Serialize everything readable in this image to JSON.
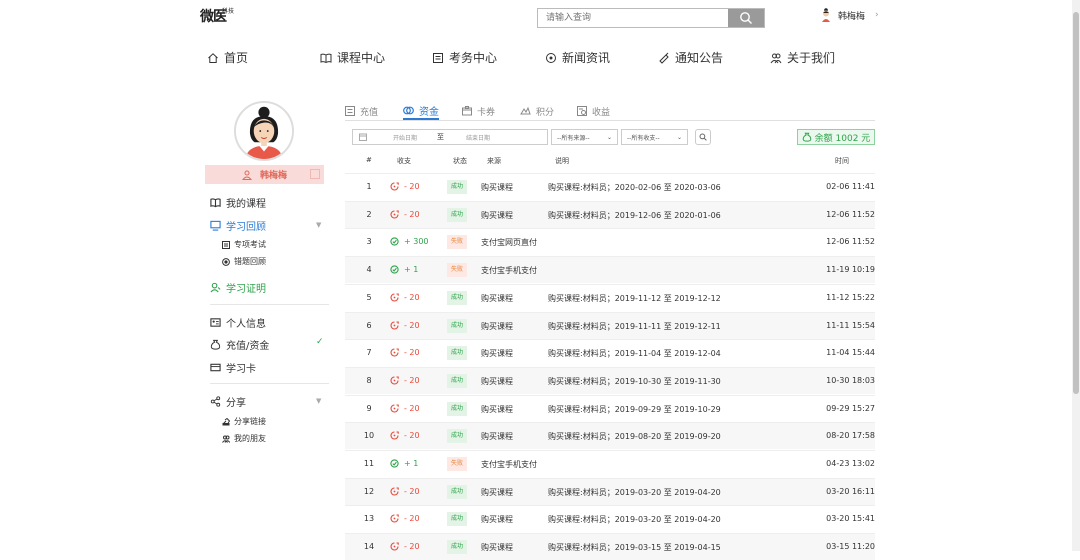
{
  "header": {
    "logo_text": "微医",
    "logo_sub": "科技",
    "search_placeholder": "请输入查询",
    "username": "韩梅梅"
  },
  "nav": [
    {
      "label": "首页",
      "icon": "home-icon"
    },
    {
      "label": "课程中心",
      "icon": "book-icon"
    },
    {
      "label": "考务中心",
      "icon": "exam-icon"
    },
    {
      "label": "新闻资讯",
      "icon": "news-icon"
    },
    {
      "label": "通知公告",
      "icon": "megaphone-icon"
    },
    {
      "label": "关于我们",
      "icon": "people-icon"
    }
  ],
  "sidebar": {
    "username": "韩梅梅",
    "items": [
      {
        "label": "我的课程"
      },
      {
        "label": "学习回顾"
      },
      {
        "label": "专项考试"
      },
      {
        "label": "错题回顾"
      },
      {
        "label": "学习证明"
      },
      {
        "label": "个人信息"
      },
      {
        "label": "充值/资金"
      },
      {
        "label": "学习卡"
      },
      {
        "label": "分享"
      },
      {
        "label": "分享链接"
      },
      {
        "label": "我的朋友"
      }
    ]
  },
  "tabs": [
    {
      "label": "充值"
    },
    {
      "label": "资金"
    },
    {
      "label": "卡券"
    },
    {
      "label": "积分"
    },
    {
      "label": "收益"
    }
  ],
  "filters": {
    "start_placeholder": "开始日期",
    "to_label": "至",
    "end_placeholder": "结束日期",
    "source_select": "--所有来源--",
    "type_select": "--所有收支--"
  },
  "balance": "余额 1002 元",
  "table": {
    "columns": [
      "#",
      "收支",
      "状态",
      "来源",
      "说明",
      "时间"
    ],
    "rows": [
      {
        "idx": "1",
        "amount": "- 20",
        "type": "out",
        "status": "成功",
        "st": "ok",
        "source": "购买课程",
        "desc": "购买课程:材料员；2020-02-06 至 2020-03-06",
        "time": "02-06 11:41"
      },
      {
        "idx": "2",
        "amount": "- 20",
        "type": "out",
        "status": "成功",
        "st": "ok",
        "source": "购买课程",
        "desc": "购买课程:材料员；2019-12-06 至 2020-01-06",
        "time": "12-06 11:52"
      },
      {
        "idx": "3",
        "amount": "+ 300",
        "type": "in",
        "status": "失败",
        "st": "fail",
        "source": "支付宝网页直付",
        "desc": "",
        "time": "12-06 11:52"
      },
      {
        "idx": "4",
        "amount": "+ 1",
        "type": "in",
        "status": "失败",
        "st": "fail",
        "source": "支付宝手机支付",
        "desc": "",
        "time": "11-19 10:19"
      },
      {
        "idx": "5",
        "amount": "- 20",
        "type": "out",
        "status": "成功",
        "st": "ok",
        "source": "购买课程",
        "desc": "购买课程:材料员；2019-11-12 至 2019-12-12",
        "time": "11-12 15:22"
      },
      {
        "idx": "6",
        "amount": "- 20",
        "type": "out",
        "status": "成功",
        "st": "ok",
        "source": "购买课程",
        "desc": "购买课程:材料员；2019-11-11 至 2019-12-11",
        "time": "11-11 15:54"
      },
      {
        "idx": "7",
        "amount": "- 20",
        "type": "out",
        "status": "成功",
        "st": "ok",
        "source": "购买课程",
        "desc": "购买课程:材料员；2019-11-04 至 2019-12-04",
        "time": "11-04 15:44"
      },
      {
        "idx": "8",
        "amount": "- 20",
        "type": "out",
        "status": "成功",
        "st": "ok",
        "source": "购买课程",
        "desc": "购买课程:材料员；2019-10-30 至 2019-11-30",
        "time": "10-30 18:03"
      },
      {
        "idx": "9",
        "amount": "- 20",
        "type": "out",
        "status": "成功",
        "st": "ok",
        "source": "购买课程",
        "desc": "购买课程:材料员；2019-09-29 至 2019-10-29",
        "time": "09-29 15:27"
      },
      {
        "idx": "10",
        "amount": "- 20",
        "type": "out",
        "status": "成功",
        "st": "ok",
        "source": "购买课程",
        "desc": "购买课程:材料员；2019-08-20 至 2019-09-20",
        "time": "08-20 17:58"
      },
      {
        "idx": "11",
        "amount": "+ 1",
        "type": "in",
        "status": "失败",
        "st": "fail",
        "source": "支付宝手机支付",
        "desc": "",
        "time": "04-23 13:02"
      },
      {
        "idx": "12",
        "amount": "- 20",
        "type": "out",
        "status": "成功",
        "st": "ok",
        "source": "购买课程",
        "desc": "购买课程:材料员；2019-03-20 至 2019-04-20",
        "time": "03-20 16:11"
      },
      {
        "idx": "13",
        "amount": "- 20",
        "type": "out",
        "status": "成功",
        "st": "ok",
        "source": "购买课程",
        "desc": "购买课程:材料员；2019-03-20 至 2019-04-20",
        "time": "03-20 15:41"
      },
      {
        "idx": "14",
        "amount": "- 20",
        "type": "out",
        "status": "成功",
        "st": "ok",
        "source": "购买课程",
        "desc": "购买课程:材料员；2019-03-15 至 2019-04-15",
        "time": "03-15 11:20"
      }
    ]
  },
  "colors": {
    "accent": "#2b7bd6",
    "success": "#2fa24b",
    "danger": "#e84a3b",
    "warn": "#e8873b"
  }
}
